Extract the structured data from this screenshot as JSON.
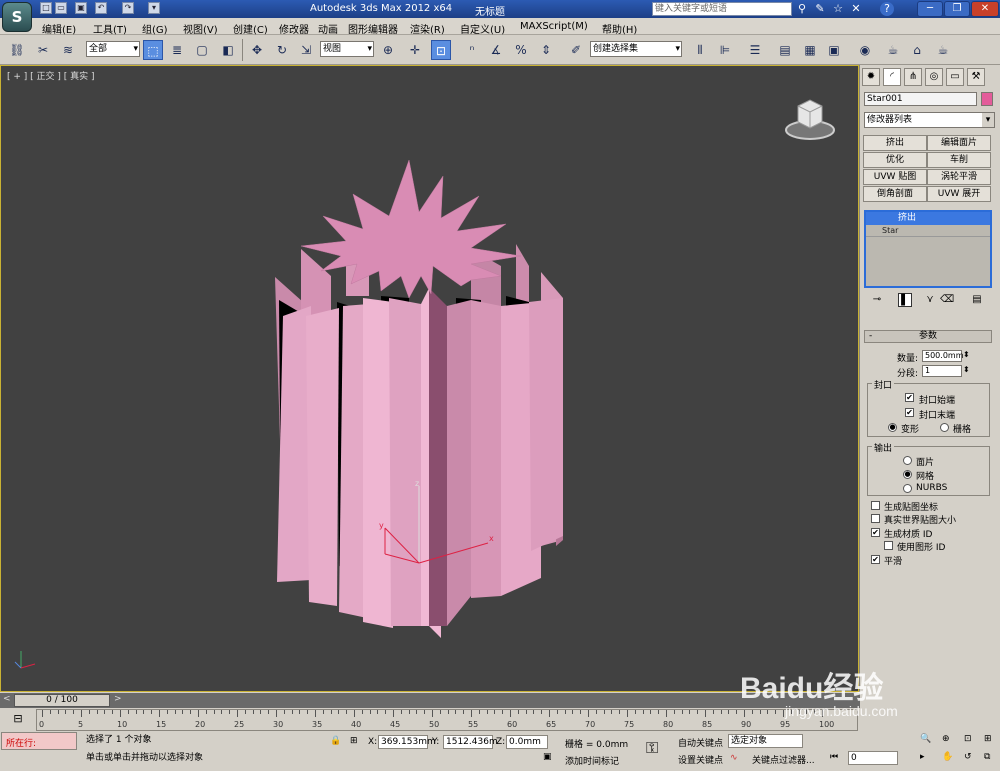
{
  "titlebar": {
    "app": "Autodesk 3ds Max  2012 x64",
    "file": "无标题",
    "search_placeholder": "键入关键字或短语"
  },
  "menus": [
    "编辑(E)",
    "工具(T)",
    "组(G)",
    "视图(V)",
    "创建(C)",
    "修改器",
    "动画",
    "图形编辑器",
    "渲染(R)",
    "自定义(U)",
    "MAXScript(M)",
    "帮助(H)"
  ],
  "toolbar": {
    "selection_filter": "全部",
    "ref_coord": "视图",
    "named_selection": "创建选择集"
  },
  "viewport": {
    "label": "[ + ] [ 正交 ] [ 真实 ]",
    "axes": [
      "x",
      "y",
      "z"
    ]
  },
  "command_panel": {
    "object_name": "Star001",
    "modifier_list": "修改器列表",
    "modifier_buttons": [
      "挤出",
      "编辑面片",
      "优化",
      "车削",
      "UVW 贴图",
      "涡轮平滑",
      "倒角剖面",
      "UVW 展开"
    ],
    "stack": [
      "挤出",
      "Star"
    ],
    "rollout_title": "参数",
    "amount_label": "数量:",
    "amount_value": "500.0mm",
    "segments_label": "分段:",
    "segments_value": "1",
    "capping_title": "封口",
    "cap_start": "封口始端",
    "cap_end": "封口末端",
    "morph": "变形",
    "grid": "栅格",
    "output_title": "输出",
    "patch": "面片",
    "mesh": "网格",
    "nurbs": "NURBS",
    "gen_map_coords": "生成贴图坐标",
    "real_world_map": "真实世界贴图大小",
    "gen_mat_ids": "生成材质 ID",
    "use_shape_ids": "使用图形 ID",
    "smooth": "平滑",
    "colors": {
      "object": "#e35c9a",
      "selection": "#3b78e0"
    }
  },
  "timeline": {
    "frame": "0 / 100",
    "ticks": [
      "0",
      "5",
      "10",
      "15",
      "20",
      "25",
      "30",
      "35",
      "40",
      "45",
      "50",
      "55",
      "60",
      "65",
      "70",
      "75",
      "80",
      "85",
      "90",
      "95",
      "100"
    ]
  },
  "status": {
    "running": "所在行:",
    "selected": "选择了 1 个对象",
    "prompt": "单击或单击并拖动以选择对象",
    "x_label": "X:",
    "x_value": "369.153mm",
    "y_label": "Y:",
    "y_value": "1512.436m",
    "z_label": "Z:",
    "z_value": "0.0mm",
    "grid": "栅格 = 0.0mm",
    "add_time_tag": "添加时间标记",
    "auto_key": "自动关键点",
    "set_key": "设置关键点",
    "selected_obj": "选定对象",
    "key_filters": "关键点过滤器...",
    "frame_input": "0"
  },
  "watermark": {
    "brand": "Baidu经验",
    "url": "jingyan.baidu.com"
  }
}
